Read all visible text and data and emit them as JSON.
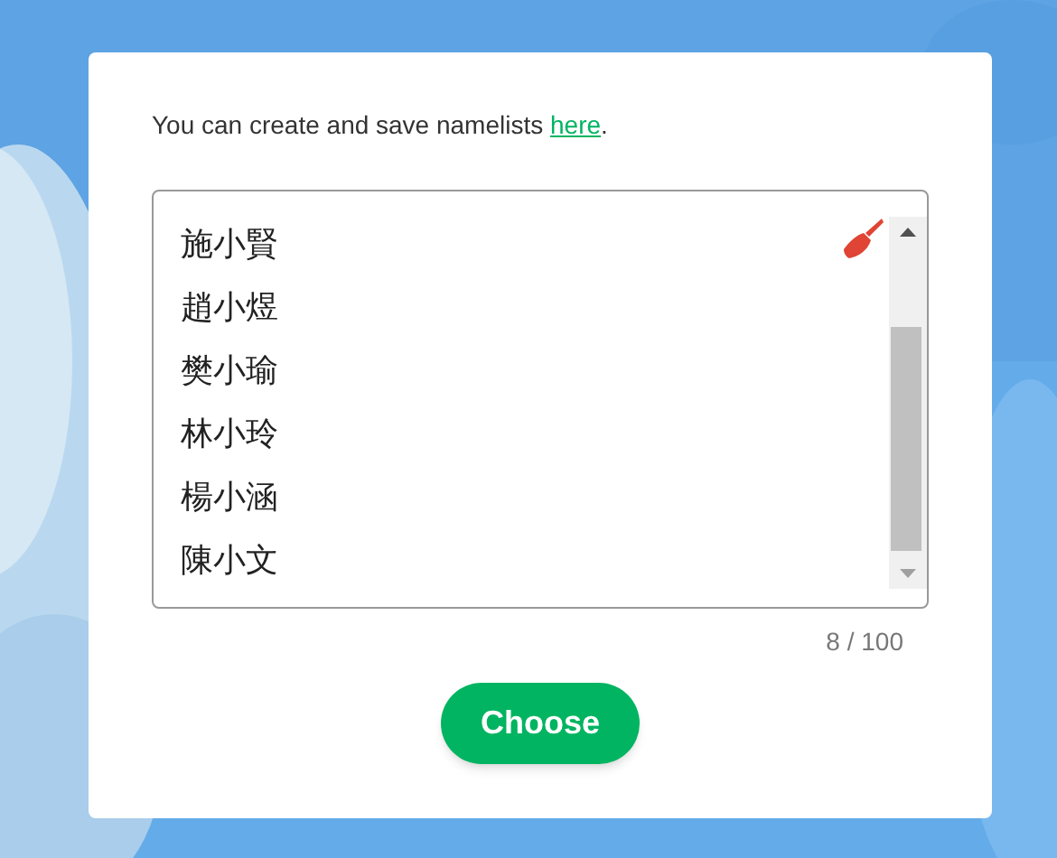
{
  "intro": {
    "text": "You can create and save namelists ",
    "link": "here",
    "end": "."
  },
  "names": [
    "施小賢",
    "趙小煜",
    "樊小瑜",
    "林小玲",
    "楊小涵",
    "陳小文"
  ],
  "counter": "8 / 100",
  "button": "Choose"
}
